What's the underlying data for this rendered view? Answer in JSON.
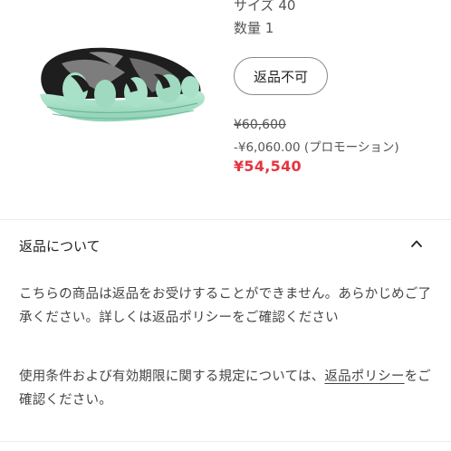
{
  "product": {
    "size_text": "サイズ 40",
    "quantity_text": "数量 1",
    "return_badge": "返品不可",
    "price_original": "¥60,600",
    "price_promo": "-¥6,060.00 (プロモーション)",
    "price_final": "¥54,540"
  },
  "returns_section": {
    "title": "返品について",
    "paragraph1": "こちらの商品は返品をお受けすることができません。あらかじめご了承ください。詳しくは返品ポリシーをご確認ください",
    "paragraph2_prefix": "使用条件および有効期限に関する規定については、",
    "paragraph2_link": "返品ポリシー",
    "paragraph2_suffix": "をご確認ください。"
  },
  "colors": {
    "price_accent": "#e5343f",
    "shoe_black": "#1e1e1e",
    "shoe_mint": "#a8e0c8",
    "shoe_grey": "#7d7d7d"
  },
  "icons": {
    "collapse": "chevron-up-icon"
  }
}
